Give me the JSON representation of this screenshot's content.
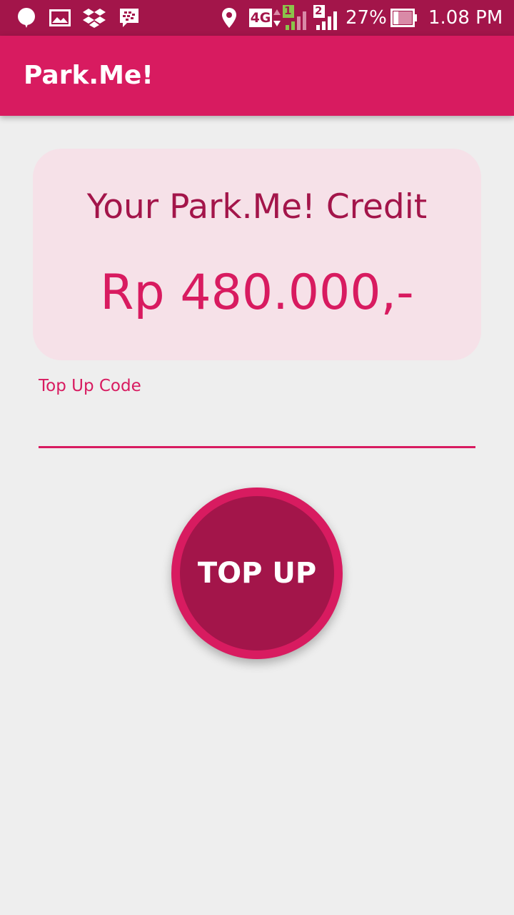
{
  "status_bar": {
    "icons": [
      "chat-bubble-icon",
      "gallery-icon",
      "dropbox-icon",
      "bbm-icon",
      "location-icon",
      "4g-data-icon",
      "signal-sim1-icon",
      "signal-sim2-icon",
      "battery-icon"
    ],
    "network": "4G",
    "sim1": "1",
    "sim2": "2",
    "battery_percent": "27%",
    "battery_level": 0.27,
    "time": "1.08 PM"
  },
  "app_bar": {
    "title": "Park.Me!"
  },
  "credit_card": {
    "heading": "Your Park.Me! Credit",
    "amount": "Rp 480.000,-"
  },
  "topup_form": {
    "label": "Top Up Code",
    "value": "",
    "button_label": "TOP UP"
  },
  "colors": {
    "status_bar": "#a3154a",
    "primary": "#d81b60",
    "primary_dark": "#a3154a",
    "card_background": "#f6e1e8",
    "page_background": "#eeeeee"
  }
}
